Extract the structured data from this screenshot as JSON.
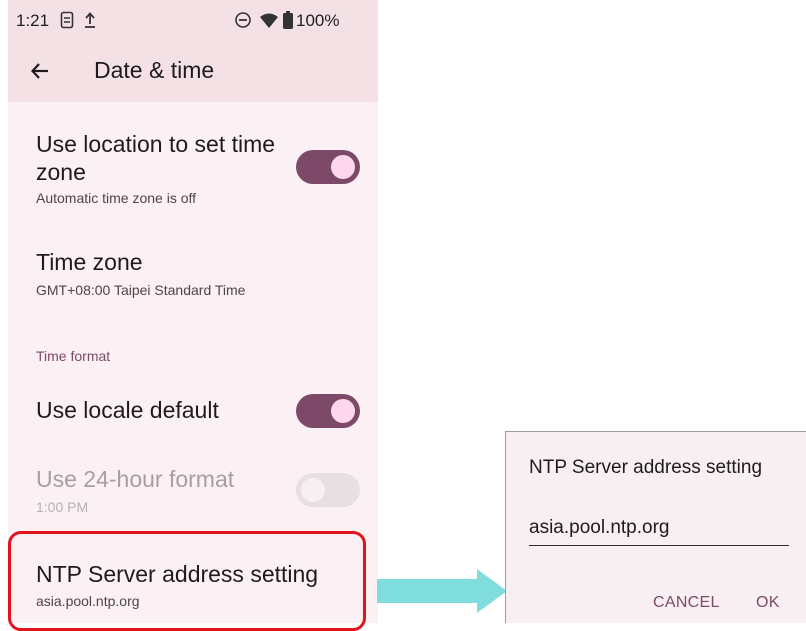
{
  "status_bar": {
    "time": "1:21",
    "icons": [
      "sim-icon",
      "upload-icon",
      "dnd-icon",
      "wifi-icon",
      "battery-icon"
    ],
    "battery": "100%"
  },
  "app_bar": {
    "title": "Date & time"
  },
  "settings": {
    "location_timezone": {
      "title": "Use location to set time zone",
      "subtitle": "Automatic time zone is off",
      "toggle_on": true
    },
    "time_zone": {
      "title": "Time zone",
      "subtitle": "GMT+08:00 Taipei Standard Time"
    },
    "time_format_header": "Time format",
    "locale_default": {
      "title": "Use locale default",
      "toggle_on": true
    },
    "hour24": {
      "title": "Use 24-hour format",
      "subtitle": "1:00 PM",
      "toggle_on": false,
      "enabled": false
    },
    "ntp": {
      "title": "NTP Server address setting",
      "subtitle": "asia.pool.ntp.org"
    }
  },
  "dialog": {
    "title": "NTP Server address setting",
    "input_value": "asia.pool.ntp.org",
    "cancel_label": "CANCEL",
    "ok_label": "OK"
  },
  "colors": {
    "accent": "#7c4a68",
    "highlight": "#e0141c",
    "arrow": "#7fdedd"
  }
}
